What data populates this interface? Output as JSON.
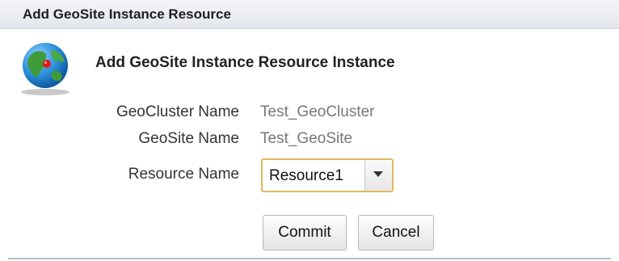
{
  "window": {
    "title": "Add GeoSite Instance Resource"
  },
  "dialog": {
    "icon": "globe-icon",
    "heading": "Add GeoSite Instance Resource Instance"
  },
  "form": {
    "geocluster_label": "GeoCluster Name",
    "geocluster_value": "Test_GeoCluster",
    "geosite_label": "GeoSite Name",
    "geosite_value": "Test_GeoSite",
    "resource_label": "Resource Name",
    "resource_selected": "Resource1"
  },
  "buttons": {
    "commit_label": "Commit",
    "cancel_label": "Cancel"
  },
  "colors": {
    "select_focus_border": "#e4b75e",
    "titlebar_bg": "#e3e6ea"
  }
}
